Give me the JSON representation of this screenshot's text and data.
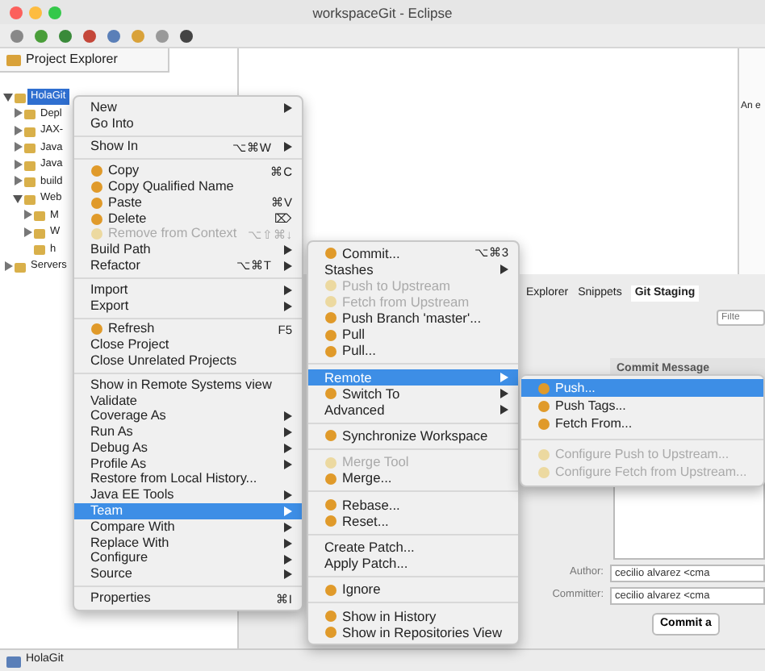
{
  "window": {
    "title": "workspaceGit - Eclipse"
  },
  "project_explorer": {
    "tab": "Project Explorer",
    "tree": [
      {
        "label": "HolaGit",
        "selected": true,
        "expanded": true,
        "children": [
          {
            "label": "Depl",
            "selected": false,
            "expanded": false
          },
          {
            "label": "JAX-",
            "selected": false,
            "expanded": false
          },
          {
            "label": "Java",
            "selected": false,
            "expanded": false
          },
          {
            "label": "Java",
            "selected": false,
            "expanded": false
          },
          {
            "label": "build",
            "selected": false,
            "expanded": false
          },
          {
            "label": "Web",
            "selected": false,
            "expanded": true,
            "children": [
              {
                "label": "M",
                "selected": false,
                "expanded": false
              },
              {
                "label": "W",
                "selected": false,
                "expanded": false
              },
              {
                "label": "h",
                "selected": false
              }
            ]
          }
        ]
      },
      {
        "label": "Servers",
        "selected": false,
        "expanded": false
      }
    ]
  },
  "side_panel": {
    "text": "An e"
  },
  "git_staging": {
    "tabs": [
      {
        "label": "Explorer",
        "selected": false
      },
      {
        "label": "Snippets",
        "selected": false
      },
      {
        "label": "Git Staging",
        "selected": true
      }
    ],
    "filter": {
      "placeholder": "Filte"
    },
    "commit_message_label": "Commit Message",
    "author_label": "Author:",
    "author": "cecilio alvarez <cma",
    "committer_label": "Committer:",
    "committer": "cecilio alvarez <cma",
    "commit_button": "Commit a"
  },
  "status_bar": {
    "text": "HolaGit"
  },
  "context_menu": {
    "groups": [
      {
        "items": [
          {
            "label": "New",
            "icon": false,
            "submenu": true,
            "disabled": false,
            "selected": false
          },
          {
            "label": "Go Into",
            "icon": false,
            "submenu": false,
            "disabled": false,
            "selected": false
          }
        ]
      },
      {
        "items": [
          {
            "label": "Show In",
            "shortcut": "⌥⌘W",
            "icon": false,
            "submenu": true,
            "disabled": false,
            "selected": false
          }
        ]
      },
      {
        "items": [
          {
            "label": "Copy",
            "shortcut": "⌘C",
            "icon": true,
            "submenu": false,
            "disabled": false,
            "selected": false
          },
          {
            "label": "Copy Qualified Name",
            "icon": true,
            "submenu": false,
            "disabled": false,
            "selected": false
          },
          {
            "label": "Paste",
            "shortcut": "⌘V",
            "icon": true,
            "submenu": false,
            "disabled": false,
            "selected": false
          },
          {
            "label": "Delete",
            "shortcut": "⌦",
            "icon": true,
            "submenu": false,
            "disabled": false,
            "selected": false
          },
          {
            "label": "Remove from Context",
            "shortcut": "⌥⇧⌘↓",
            "icon": true,
            "submenu": false,
            "disabled": true,
            "selected": false
          },
          {
            "label": "Build Path",
            "icon": false,
            "submenu": true,
            "disabled": false,
            "selected": false
          },
          {
            "label": "Refactor",
            "shortcut": "⌥⌘T",
            "icon": false,
            "submenu": true,
            "disabled": false,
            "selected": false
          }
        ]
      },
      {
        "items": [
          {
            "label": "Import",
            "icon": false,
            "submenu": true,
            "disabled": false,
            "selected": false
          },
          {
            "label": "Export",
            "icon": false,
            "submenu": true,
            "disabled": false,
            "selected": false
          }
        ]
      },
      {
        "items": [
          {
            "label": "Refresh",
            "shortcut": "F5",
            "icon": true,
            "submenu": false,
            "disabled": false,
            "selected": false
          },
          {
            "label": "Close Project",
            "icon": false,
            "submenu": false,
            "disabled": false,
            "selected": false
          },
          {
            "label": "Close Unrelated Projects",
            "icon": false,
            "submenu": false,
            "disabled": false,
            "selected": false
          }
        ]
      },
      {
        "items": [
          {
            "label": "Show in Remote Systems view",
            "icon": false,
            "submenu": false,
            "disabled": false,
            "selected": false
          },
          {
            "label": "Validate",
            "icon": false,
            "submenu": false,
            "disabled": false,
            "selected": false
          },
          {
            "label": "Coverage As",
            "icon": false,
            "submenu": true,
            "disabled": false,
            "selected": false
          },
          {
            "label": "Run As",
            "icon": false,
            "submenu": true,
            "disabled": false,
            "selected": false
          },
          {
            "label": "Debug As",
            "icon": false,
            "submenu": true,
            "disabled": false,
            "selected": false
          },
          {
            "label": "Profile As",
            "icon": false,
            "submenu": true,
            "disabled": false,
            "selected": false
          },
          {
            "label": "Restore from Local History...",
            "icon": false,
            "submenu": false,
            "disabled": false,
            "selected": false
          },
          {
            "label": "Java EE Tools",
            "icon": false,
            "submenu": true,
            "disabled": false,
            "selected": false
          },
          {
            "label": "Team",
            "icon": false,
            "submenu": true,
            "disabled": false,
            "selected": true
          },
          {
            "label": "Compare With",
            "icon": false,
            "submenu": true,
            "disabled": false,
            "selected": false
          },
          {
            "label": "Replace With",
            "icon": false,
            "submenu": true,
            "disabled": false,
            "selected": false
          },
          {
            "label": "Configure",
            "icon": false,
            "submenu": true,
            "disabled": false,
            "selected": false
          },
          {
            "label": "Source",
            "icon": false,
            "submenu": true,
            "disabled": false,
            "selected": false
          }
        ]
      },
      {
        "items": [
          {
            "label": "Properties",
            "shortcut": "⌘I",
            "icon": false,
            "submenu": false,
            "disabled": false,
            "selected": false
          }
        ]
      }
    ]
  },
  "team_submenu": {
    "groups": [
      {
        "items": [
          {
            "label": "Commit...",
            "shortcut": "⌥⌘3",
            "icon": true,
            "submenu": false,
            "disabled": false,
            "selected": false
          },
          {
            "label": "Stashes",
            "icon": false,
            "submenu": true,
            "disabled": false,
            "selected": false
          },
          {
            "label": "Push to Upstream",
            "icon": true,
            "submenu": false,
            "disabled": true,
            "selected": false
          },
          {
            "label": "Fetch from Upstream",
            "icon": true,
            "submenu": false,
            "disabled": true,
            "selected": false
          },
          {
            "label": "Push Branch 'master'...",
            "icon": true,
            "submenu": false,
            "disabled": false,
            "selected": false
          },
          {
            "label": "Pull",
            "icon": true,
            "submenu": false,
            "disabled": false,
            "selected": false
          },
          {
            "label": "Pull...",
            "icon": true,
            "submenu": false,
            "disabled": false,
            "selected": false
          }
        ]
      },
      {
        "items": [
          {
            "label": "Remote",
            "icon": false,
            "submenu": true,
            "disabled": false,
            "selected": true
          },
          {
            "label": "Switch To",
            "icon": true,
            "submenu": true,
            "disabled": false,
            "selected": false
          },
          {
            "label": "Advanced",
            "icon": false,
            "submenu": true,
            "disabled": false,
            "selected": false
          }
        ]
      },
      {
        "items": [
          {
            "label": "Synchronize Workspace",
            "icon": true,
            "submenu": false,
            "disabled": false,
            "selected": false
          }
        ]
      },
      {
        "items": [
          {
            "label": "Merge Tool",
            "icon": true,
            "submenu": false,
            "disabled": true,
            "selected": false
          },
          {
            "label": "Merge...",
            "icon": true,
            "submenu": false,
            "disabled": false,
            "selected": false
          }
        ]
      },
      {
        "items": [
          {
            "label": "Rebase...",
            "icon": true,
            "submenu": false,
            "disabled": false,
            "selected": false
          },
          {
            "label": "Reset...",
            "icon": true,
            "submenu": false,
            "disabled": false,
            "selected": false
          }
        ]
      },
      {
        "items": [
          {
            "label": "Create Patch...",
            "icon": false,
            "submenu": false,
            "disabled": false,
            "selected": false
          },
          {
            "label": "Apply Patch...",
            "icon": false,
            "submenu": false,
            "disabled": false,
            "selected": false
          }
        ]
      },
      {
        "items": [
          {
            "label": "Ignore",
            "icon": true,
            "submenu": false,
            "disabled": false,
            "selected": false
          }
        ]
      },
      {
        "items": [
          {
            "label": "Show in History",
            "icon": true,
            "submenu": false,
            "disabled": false,
            "selected": false
          },
          {
            "label": "Show in Repositories View",
            "icon": true,
            "submenu": false,
            "disabled": false,
            "selected": false
          }
        ]
      }
    ]
  },
  "remote_submenu": {
    "groups": [
      {
        "items": [
          {
            "label": "Push...",
            "icon": true,
            "submenu": false,
            "disabled": false,
            "selected": true
          },
          {
            "label": "Push Tags...",
            "icon": true,
            "submenu": false,
            "disabled": false,
            "selected": false
          },
          {
            "label": "Fetch From...",
            "icon": true,
            "submenu": false,
            "disabled": false,
            "selected": false
          }
        ]
      },
      {
        "items": [
          {
            "label": "Configure Push to Upstream...",
            "icon": true,
            "submenu": false,
            "disabled": true,
            "selected": false
          },
          {
            "label": "Configure Fetch from Upstream...",
            "icon": true,
            "submenu": false,
            "disabled": true,
            "selected": false
          }
        ]
      }
    ]
  }
}
